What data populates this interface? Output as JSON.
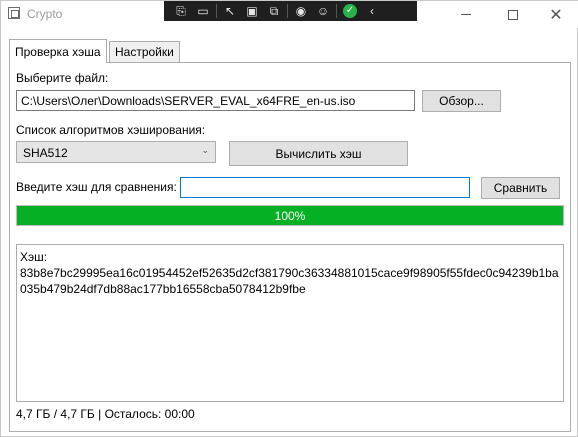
{
  "window": {
    "title": "Crypto"
  },
  "overlay_toolbar": {
    "icons": [
      "capture-icon",
      "record-icon",
      "pointer-icon",
      "region-icon",
      "window-capture-icon",
      "broadcast-icon",
      "accessibility-icon",
      "checkmark-icon",
      "collapse-icon"
    ]
  },
  "tabs": [
    {
      "label": "Проверка хэша",
      "active": true
    },
    {
      "label": "Настройки",
      "active": false
    }
  ],
  "file": {
    "label": "Выберите файл:",
    "path": "C:\\Users\\Олег\\Downloads\\SERVER_EVAL_x64FRE_en-us.iso",
    "browse_label": "Обзор..."
  },
  "algorithm": {
    "label": "Список алгоритмов хэширования:",
    "selected": "SHA512",
    "compute_label": "Вычислить хэш"
  },
  "compare": {
    "label": "Введите хэш для сравнения:",
    "value": "",
    "button_label": "Сравнить"
  },
  "progress": {
    "value": 1.0,
    "text": "100%",
    "color": "#06b025"
  },
  "result": {
    "text": "Хэш:\n83b8e7bc29995ea16c01954452ef52635d2cf381790c36334881015cace9f98905f55fdec0c94239b1ba035b479b24df7db88ac177bb16558cba5078412b9fbe"
  },
  "status": {
    "text": "4,7 ГБ / 4,7 ГБ | Осталось: 00:00"
  }
}
